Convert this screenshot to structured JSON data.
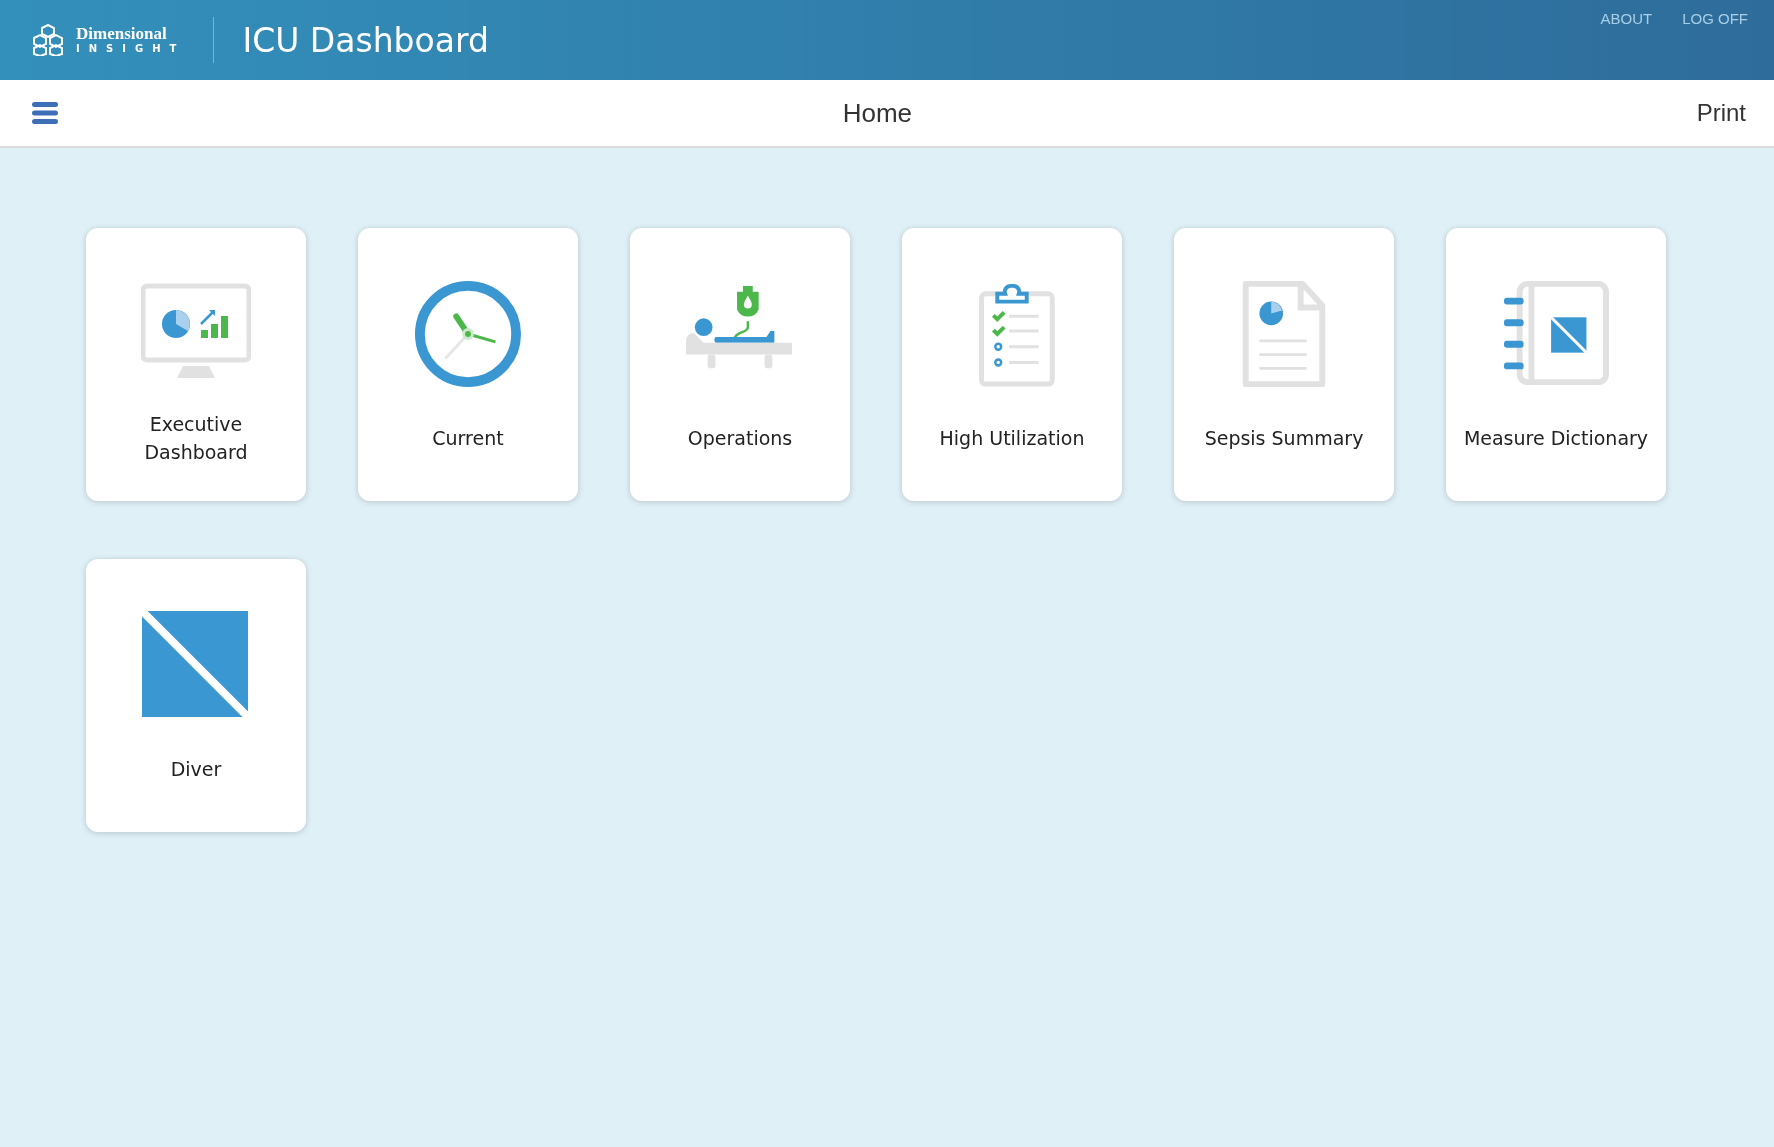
{
  "header": {
    "logo": {
      "line_1": "Dimensional",
      "line_2": "INSIGHT"
    },
    "title": "ICU Dashboard",
    "links": [
      "ABOUT",
      "LOG OFF"
    ]
  },
  "toolbar": {
    "title": "Home",
    "action": "Print"
  },
  "tiles": [
    {
      "kind": "monitor",
      "label": "Executive Dashboard"
    },
    {
      "kind": "clock",
      "label": "Current"
    },
    {
      "kind": "patient",
      "label": "Operations"
    },
    {
      "kind": "clipboard",
      "label": "High Utilization"
    },
    {
      "kind": "document",
      "label": "Sepsis Summary"
    },
    {
      "kind": "notebook",
      "label": "Measure Dictionary"
    },
    {
      "kind": "diver",
      "label": "Diver"
    }
  ]
}
